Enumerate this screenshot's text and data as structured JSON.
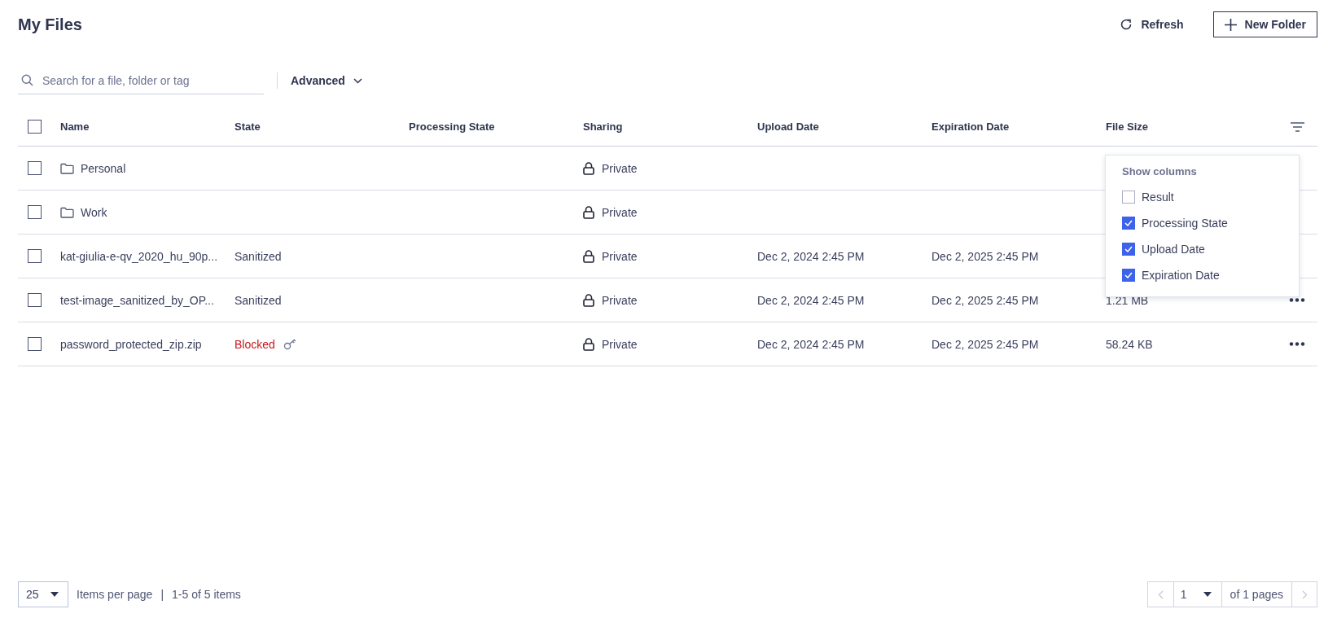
{
  "title": "My Files",
  "actions": [
    {
      "kind": "refresh",
      "label": "Refresh"
    },
    {
      "kind": "new-folder",
      "label": "New Folder"
    }
  ],
  "search": {
    "placeholder": "Search for a file, folder or tag"
  },
  "advanced": {
    "label": "Advanced"
  },
  "table": {
    "select_all": {
      "checked": false
    },
    "columns": [
      "Name",
      "State",
      "Processing State",
      "Sharing",
      "Upload Date",
      "Expiration Date",
      "File Size"
    ],
    "rows": [
      {
        "kind": "folder",
        "name": "Personal",
        "checked": false,
        "sharing": "Private",
        "actions": false
      },
      {
        "kind": "folder",
        "name": "Work",
        "checked": false,
        "sharing": "Private",
        "actions": false
      },
      {
        "kind": "file",
        "name": "kat-giulia-e-qv_2020_hu_90p...",
        "checked": false,
        "state": "Sanitized",
        "blocked": false,
        "sharing": "Private",
        "upload": "Dec 2, 2024 2:45 PM",
        "expiration": "Dec 2, 2025 2:45 PM",
        "actions": false
      },
      {
        "kind": "file",
        "name": "test-image_sanitized_by_OP...",
        "checked": false,
        "state": "Sanitized",
        "blocked": false,
        "sharing": "Private",
        "upload": "Dec 2, 2024 2:45 PM",
        "expiration": "Dec 2, 2025 2:45 PM",
        "size": "1.21 MB",
        "actions": true
      },
      {
        "kind": "file",
        "name": "password_protected_zip.zip",
        "checked": false,
        "state": "Blocked",
        "blocked": true,
        "sharing": "Private",
        "upload": "Dec 2, 2024 2:45 PM",
        "expiration": "Dec 2, 2025 2:45 PM",
        "size": "58.24 KB",
        "actions": true
      }
    ]
  },
  "column_menu": {
    "title": "Show columns",
    "items": [
      {
        "label": "Result",
        "checked": false
      },
      {
        "label": "Processing State",
        "checked": true
      },
      {
        "label": "Upload Date",
        "checked": true
      },
      {
        "label": "Expiration Date",
        "checked": true
      }
    ]
  },
  "pagination": {
    "per_page": "25",
    "per_page_label": "Items per page",
    "separator": "|",
    "range": "1-5 of 5 items",
    "page": "1",
    "of_pages": "of 1 pages"
  }
}
